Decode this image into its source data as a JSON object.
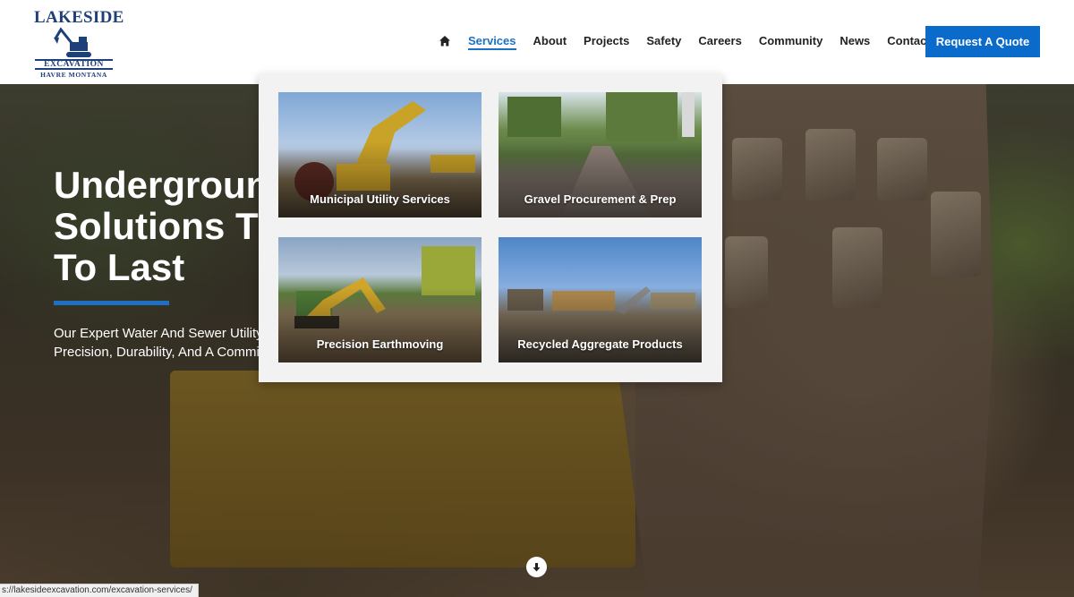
{
  "logo": {
    "name_top": "LAKESIDE",
    "name_band": "EXCAVATION",
    "location": "HAVRE MONTANA"
  },
  "nav": {
    "home_icon": "home-icon",
    "items": [
      {
        "label": "Services",
        "active": true
      },
      {
        "label": "About"
      },
      {
        "label": "Projects"
      },
      {
        "label": "Safety"
      },
      {
        "label": "Careers"
      },
      {
        "label": "Community"
      },
      {
        "label": "News"
      },
      {
        "label": "Contact"
      }
    ],
    "cta_label": "Request A Quote",
    "accent_color": "#0b6bcb"
  },
  "hero": {
    "title_line1": "Underground",
    "title_line2": "Solutions That",
    "title_line3": "To Last",
    "text_line1": "Our Expert Water And Sewer Utility",
    "text_line2": "Precision, Durability, And A Commitment"
  },
  "services_menu": {
    "cards": [
      {
        "label": "Municipal Utility Services"
      },
      {
        "label": "Gravel Procurement & Prep"
      },
      {
        "label": "Precision Earthmoving"
      },
      {
        "label": "Recycled Aggregate Products"
      }
    ]
  },
  "status_bar": {
    "url": "s://lakesideexcavation.com/excavation-services/"
  }
}
